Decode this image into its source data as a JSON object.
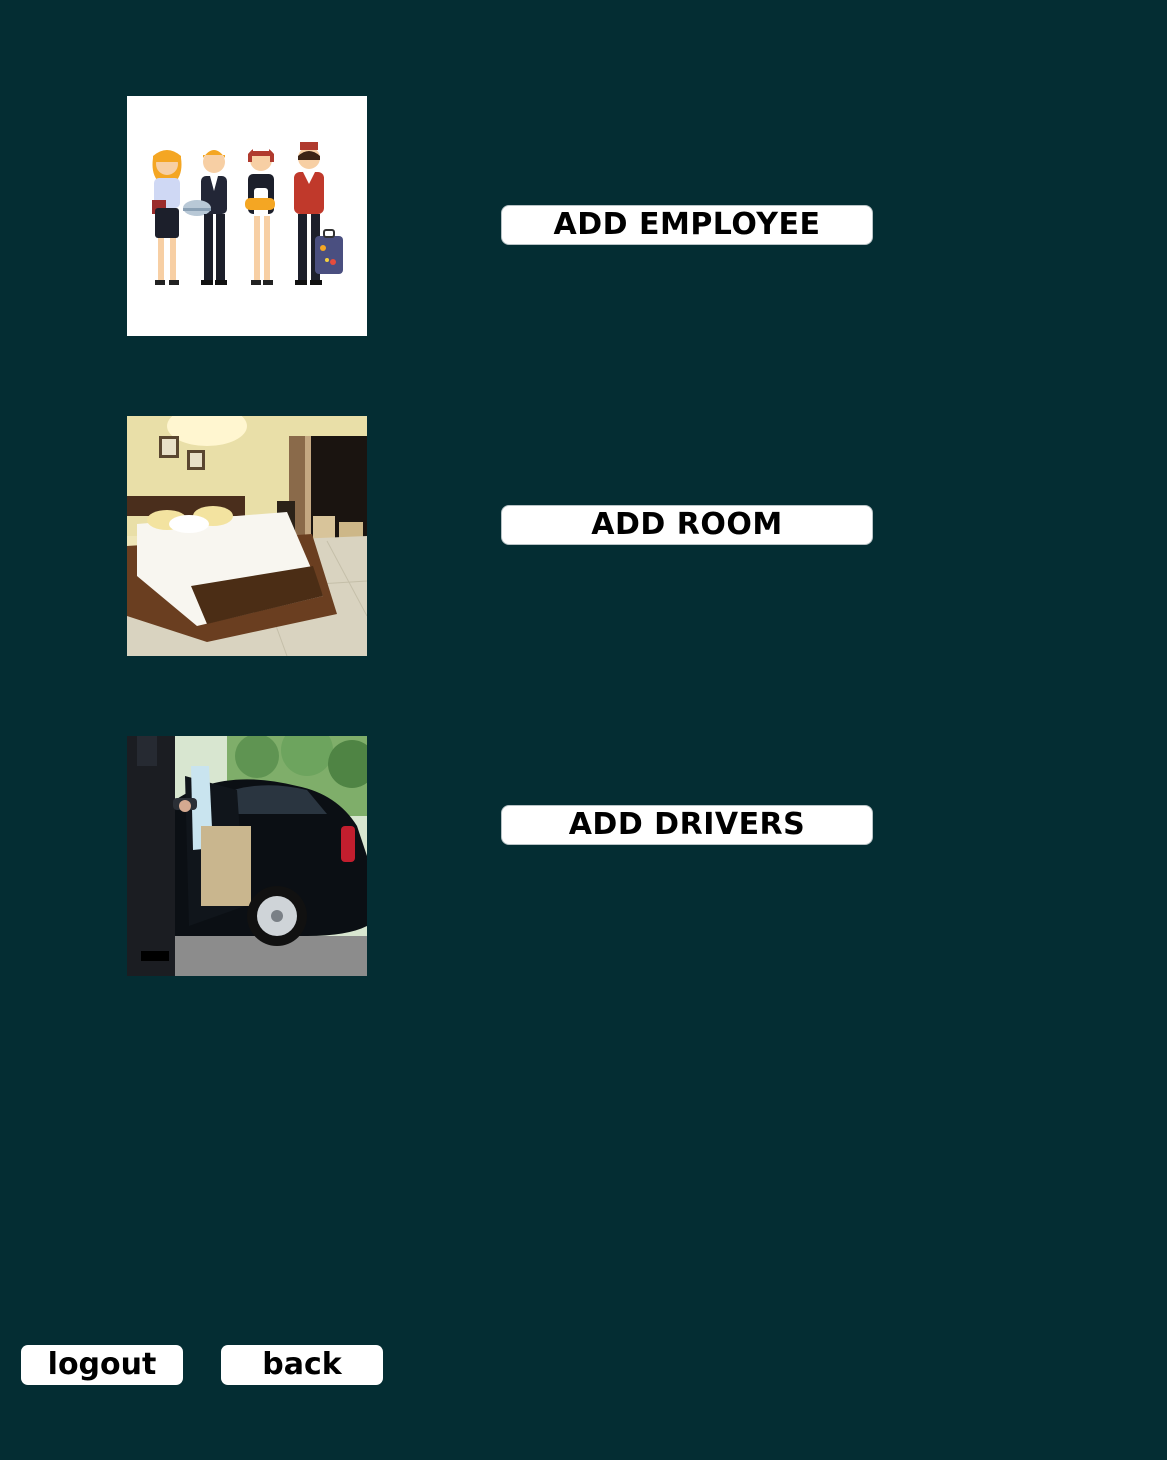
{
  "actions": {
    "add_employee_label": "ADD EMPLOYEE",
    "add_room_label": "ADD ROOM",
    "add_drivers_label": "ADD DRIVERS"
  },
  "footer": {
    "logout_label": "logout",
    "back_label": "back"
  },
  "images": {
    "employees": "hotel-staff-illustration",
    "room": "hotel-room-photo",
    "driver": "chauffeur-car-photo"
  },
  "colors": {
    "background": "#042d33",
    "button_bg": "#ffffff",
    "button_text": "#000000"
  }
}
